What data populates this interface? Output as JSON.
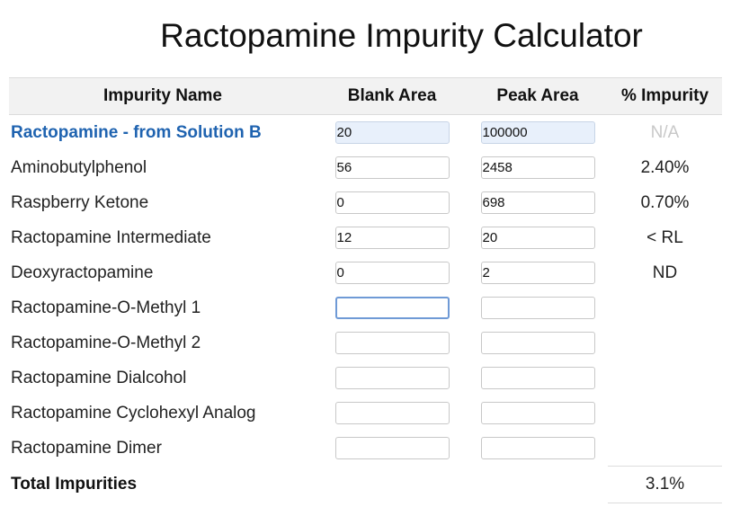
{
  "page": {
    "title": "Ractopamine Impurity Calculator"
  },
  "table": {
    "headers": {
      "name": "Impurity Name",
      "blank": "Blank Area",
      "peak": "Peak Area",
      "pct": "% Impurity"
    },
    "rows": [
      {
        "name": "Ractopamine - from Solution B",
        "blank": "20",
        "peak": "100000",
        "pct": "N/A"
      },
      {
        "name": "Aminobutylphenol",
        "blank": "56",
        "peak": "2458",
        "pct": "2.40%"
      },
      {
        "name": "Raspberry Ketone",
        "blank": "0",
        "peak": "698",
        "pct": "0.70%"
      },
      {
        "name": "Ractopamine Intermediate",
        "blank": "12",
        "peak": "20",
        "pct": "< RL"
      },
      {
        "name": "Deoxyractopamine",
        "blank": "0",
        "peak": "2",
        "pct": "ND"
      },
      {
        "name": "Ractopamine-O-Methyl 1",
        "blank": "",
        "peak": "",
        "pct": ""
      },
      {
        "name": "Ractopamine-O-Methyl 2",
        "blank": "",
        "peak": "",
        "pct": ""
      },
      {
        "name": "Ractopamine Dialcohol",
        "blank": "",
        "peak": "",
        "pct": ""
      },
      {
        "name": "Ractopamine Cyclohexyl Analog",
        "blank": "",
        "peak": "",
        "pct": ""
      },
      {
        "name": "Ractopamine Dimer",
        "blank": "",
        "peak": "",
        "pct": ""
      }
    ],
    "total": {
      "label": "Total Impurities",
      "value": "3.1%"
    }
  },
  "colors": {
    "accent_text": "#1f63b0",
    "header_bg": "#f2f2f2",
    "reference_input_bg": "#e8f0fb",
    "na_text": "#c8c8c8"
  }
}
